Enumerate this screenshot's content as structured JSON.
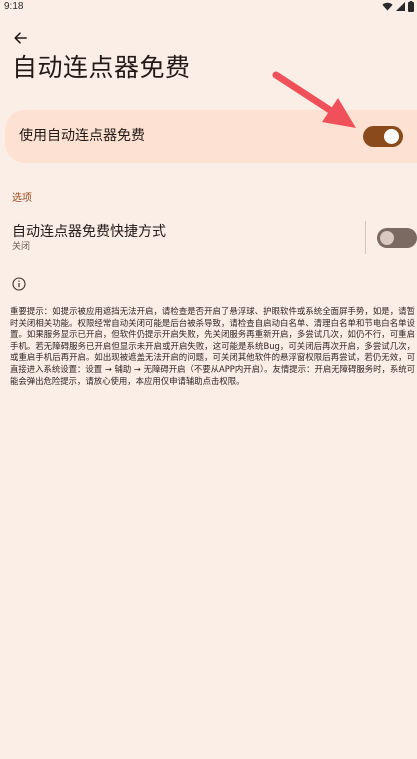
{
  "status_bar": {
    "time": "9:18"
  },
  "header": {
    "title": "自动连点器免费"
  },
  "main_toggle": {
    "label": "使用自动连点器免费",
    "state": "on",
    "accent_color": "#8a4a1c"
  },
  "options_section": {
    "header": "选项",
    "shortcut": {
      "title": "自动连点器免费快捷方式",
      "subtitle": "关闭",
      "state": "off"
    }
  },
  "notice": {
    "text": "重要提示：如提示被应用遮挡无法开启，请检查是否开启了悬浮球、护眼软件或系统全面屏手势，如是，请暂时关闭相关功能。权限经常自动关闭可能是后台被杀导致，请检查自启动白名单、清理白名单和节电白名单设置。如果服务显示已开启，但软件仍提示开启失败，先关闭服务再重新开启，多尝试几次，如仍不行，可重启手机。若无障碍服务已开启但显示未开启或开启失败，这可能是系统Bug，可关闭后再次开启，多尝试几次，或重启手机后再开启。如出现被遮盖无法开启的问题，可关闭其他软件的悬浮窗权限后再尝试，若仍无效，可直接进入系统设置：设置 → 辅助 → 无障碍开启（不要从APP内开启）。友情提示：开启无障碍服务时，系统可能会弹出危险提示，请放心使用，本应用仅申请辅助点击权限。"
  },
  "annotation": {
    "color": "#f0505a"
  },
  "icons": {
    "back": "back-arrow-icon",
    "info": "info-icon",
    "wifi": "wifi-icon",
    "signal": "signal-icon",
    "battery": "battery-icon"
  }
}
